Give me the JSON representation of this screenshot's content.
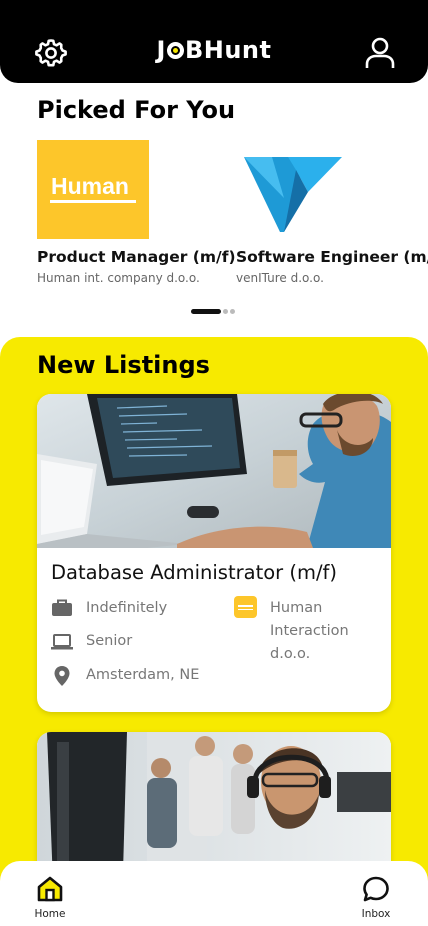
{
  "header": {
    "logo_left": "J",
    "logo_right": "BHunt",
    "settings_icon": "gear-icon",
    "profile_icon": "user-icon"
  },
  "picked": {
    "title": "Picked For You",
    "items": [
      {
        "logo_text": "Human",
        "title": "Product Manager (m/f)",
        "company": "Human int. company d.o.o."
      },
      {
        "title": "Software Engineer (m/f)",
        "company": "venITure d.o.o."
      }
    ],
    "pagination": {
      "pages": 3,
      "active": 0
    }
  },
  "listings": {
    "title": "New Listings",
    "jobs": [
      {
        "title": "Database Administrator (m/f)",
        "contract": "Indefinitely",
        "level": "Senior",
        "location": "Amsterdam, NE",
        "company": "Human Interaction d.o.o."
      }
    ]
  },
  "nav": {
    "home": "Home",
    "inbox": "Inbox"
  },
  "colors": {
    "accent": "#f7ea00",
    "header": "#000000",
    "human_brand": "#fdc62a",
    "venture_brand": "#1e9ad6"
  }
}
